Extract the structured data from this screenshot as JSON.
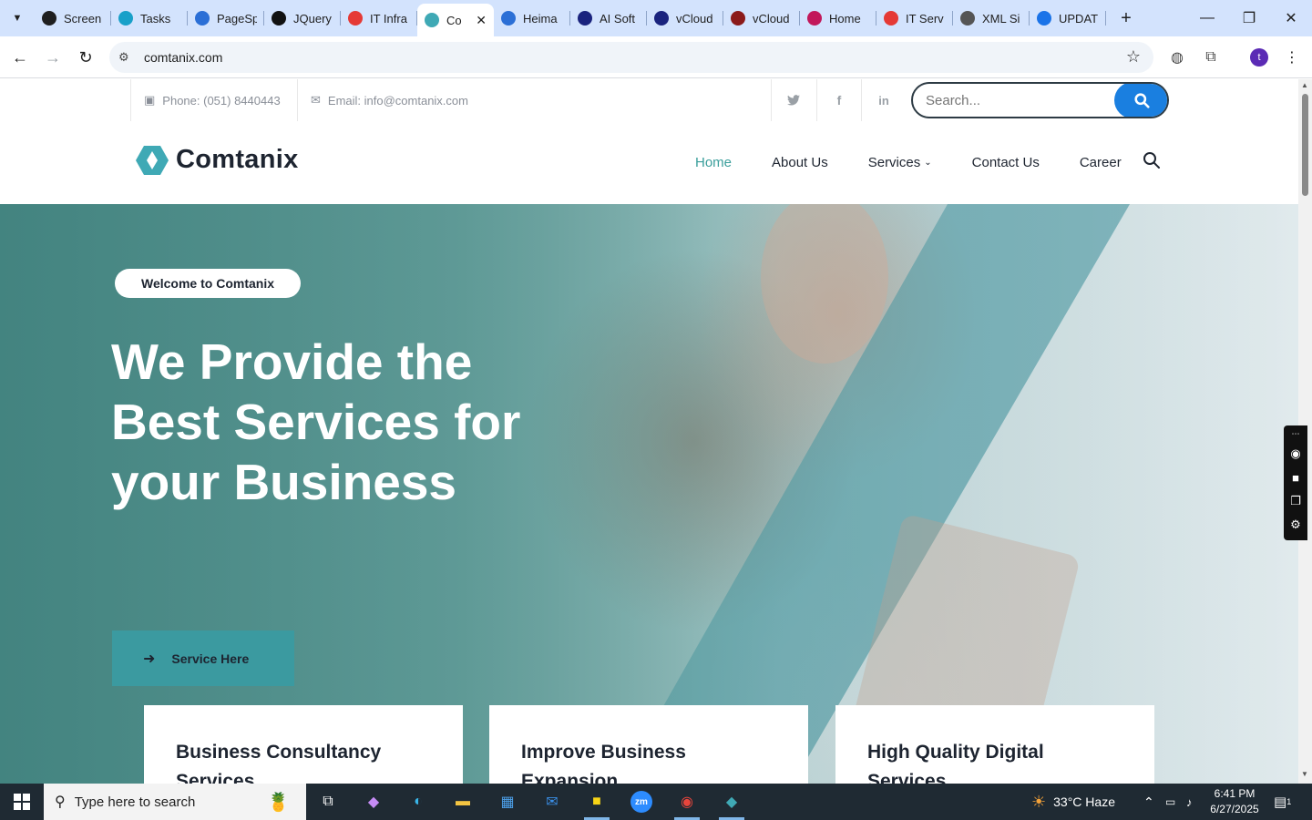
{
  "browser": {
    "tabs": [
      {
        "label": "Screen",
        "icon_color": "#1f1f1f",
        "icon": "screencast-icon"
      },
      {
        "label": "Tasks",
        "icon_color": "#18a0c9",
        "icon": "tasks-icon"
      },
      {
        "label": "PageSp",
        "icon_color": "#2b6fd6",
        "icon": "pagespeed-icon"
      },
      {
        "label": "JQuery",
        "icon_color": "#111111",
        "icon": "openai-icon"
      },
      {
        "label": "IT Infra",
        "icon_color": "#e53935",
        "icon": "diamond-icon"
      },
      {
        "label": "Co",
        "icon_color": "#3fa9b5",
        "icon": "comtanix-icon",
        "active": true
      },
      {
        "label": "Heima",
        "icon_color": "#2b6fd6",
        "icon": "scales-icon"
      },
      {
        "label": "AI Soft",
        "icon_color": "#1a237e",
        "icon": "x-logo-icon"
      },
      {
        "label": "vCloud",
        "icon_color": "#1a237e",
        "icon": "check-logo-icon"
      },
      {
        "label": "vCloud",
        "icon_color": "#8b1a1a",
        "icon": "v-logo-icon"
      },
      {
        "label": "Home",
        "icon_color": "#c2185b",
        "icon": "home-logo-icon"
      },
      {
        "label": "IT Serv",
        "icon_color": "#e53935",
        "icon": "diamond-icon"
      },
      {
        "label": "XML Si",
        "icon_color": "#555555",
        "icon": "globe-icon"
      },
      {
        "label": "UPDAT",
        "icon_color": "#1a73e8",
        "icon": "docs-icon"
      }
    ],
    "url": "comtanix.com",
    "profile_initial": "t"
  },
  "site": {
    "phone": "Phone: (051) 8440443",
    "email": "Email: info@comtanix.com",
    "search_placeholder": "Search...",
    "brand": "Comtanix",
    "nav": [
      {
        "label": "Home",
        "active": true
      },
      {
        "label": "About Us"
      },
      {
        "label": "Services",
        "has_dropdown": true
      },
      {
        "label": "Contact Us"
      },
      {
        "label": "Career"
      }
    ],
    "hero": {
      "badge": "Welcome to Comtanix",
      "title_lines": [
        "We Provide the",
        "Best Services for",
        "your Business"
      ],
      "cta": "Service Here"
    },
    "cards": [
      {
        "title": "Business Consultancy Services"
      },
      {
        "title": "Improve Business Expansion"
      },
      {
        "title": "High Quality Digital Services"
      }
    ],
    "colors": {
      "accent": "#3a9e9b",
      "search_button": "#1a7fe0",
      "cta": "#3b9aa0"
    }
  },
  "taskbar": {
    "search_placeholder": "Type here to search",
    "weather": "33°C  Haze",
    "time": "6:41 PM",
    "date": "6/27/2025",
    "notification_count": "1"
  }
}
